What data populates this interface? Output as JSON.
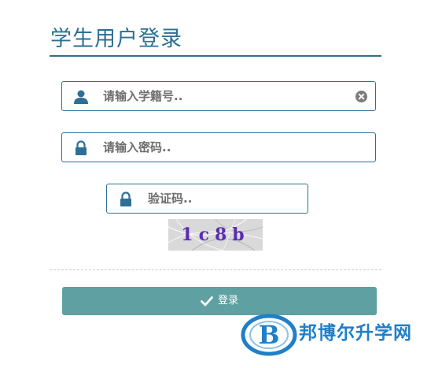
{
  "page": {
    "title": "学生用户登录"
  },
  "form": {
    "student_id": {
      "placeholder": "请输入学籍号.."
    },
    "password": {
      "placeholder": "请输入密码.."
    },
    "verify_code": {
      "placeholder": "验证码.."
    }
  },
  "captcha": {
    "code": "1c8b"
  },
  "login_button": {
    "label": "登录"
  },
  "watermark": {
    "text": "邦博尔升学网",
    "logo_letter": "B"
  },
  "colors": {
    "title": "#2b6f93",
    "field_border": "#2f6f93",
    "icon": "#2e6f96",
    "button_bg": "#5fa0a3",
    "watermark": "#1f7fc9"
  },
  "icons": {
    "student_id": "user-icon",
    "password": "lock-icon",
    "verify_code": "lock-icon",
    "clear": "clear-circle-icon",
    "login": "check-icon"
  }
}
